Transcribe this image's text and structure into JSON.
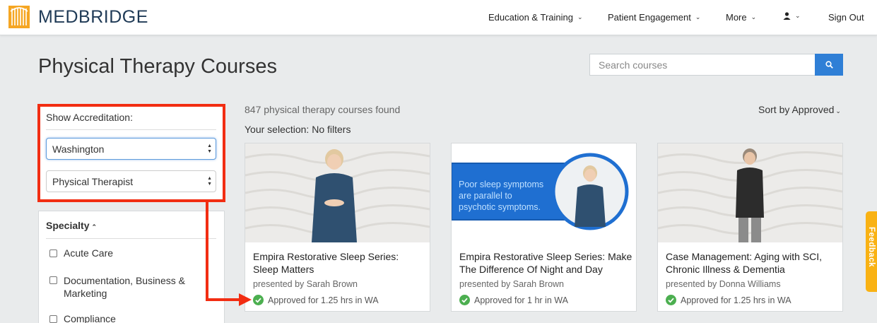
{
  "header": {
    "logo_text": "MEDBRIDGE",
    "nav": {
      "education": "Education & Training",
      "patient": "Patient Engagement",
      "more": "More",
      "sign_out": "Sign Out"
    }
  },
  "page": {
    "title": "Physical Therapy Courses"
  },
  "search": {
    "placeholder": "Search courses"
  },
  "accreditation": {
    "label": "Show Accreditation:",
    "state": "Washington",
    "profession": "Physical Therapist"
  },
  "specialty": {
    "title": "Specialty",
    "options": [
      "Acute Care",
      "Documentation, Business & Marketing",
      "Compliance"
    ]
  },
  "results": {
    "count_text": "847 physical therapy courses found",
    "selection_text": "Your selection: No filters",
    "sort_text": "Sort by Approved"
  },
  "courses": [
    {
      "title": "Empira Restorative Sleep Series: Sleep Matters",
      "presenter": "presented by Sarah Brown",
      "approved": "Approved for 1.25 hrs in WA"
    },
    {
      "title": "Empira Restorative Sleep Series: Make The Difference Of Night and Day",
      "presenter": "presented by Sarah Brown",
      "approved": "Approved for 1 hr in WA",
      "thumb_caption_lines": [
        "Poor sleep symptoms",
        "are parallel to",
        "psychotic symptoms."
      ]
    },
    {
      "title": "Case Management: Aging with SCI, Chronic Illness & Dementia",
      "presenter": "presented by Donna Williams",
      "approved": "Approved for 1.25 hrs in WA"
    }
  ],
  "feedback": {
    "label": "Feedback"
  },
  "colors": {
    "brand_navy": "#1f3a56",
    "brand_orange": "#f5a623",
    "search_button": "#2f7fd6",
    "highlight_red": "#f22d12",
    "approved_green": "#4caf50",
    "feedback_tab": "#f9b214"
  }
}
